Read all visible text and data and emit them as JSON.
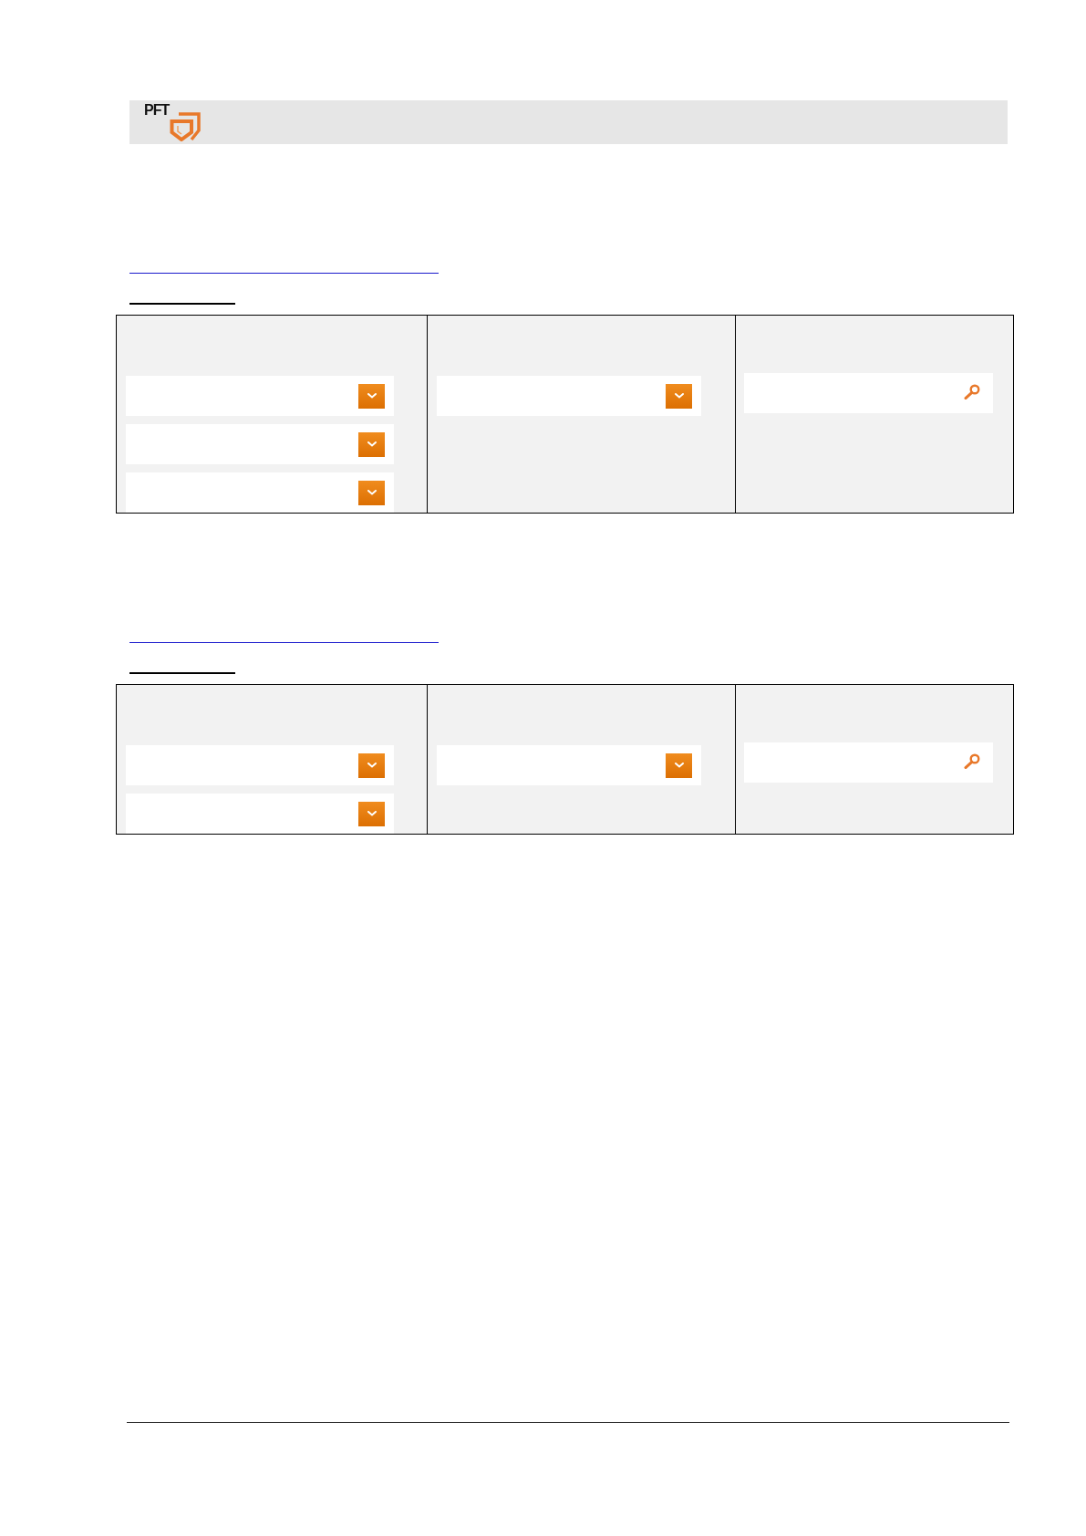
{
  "header": {
    "logo": {
      "text": "PFT"
    }
  },
  "sections": [
    {
      "table": {
        "columns": [
          {
            "fields": [
              {
                "kind": "dropdown"
              },
              {
                "kind": "dropdown"
              },
              {
                "kind": "dropdown"
              }
            ]
          },
          {
            "fields": [
              {
                "kind": "dropdown"
              }
            ]
          },
          {
            "fields": [
              {
                "kind": "search"
              }
            ]
          }
        ]
      }
    },
    {
      "table": {
        "columns": [
          {
            "fields": [
              {
                "kind": "dropdown"
              },
              {
                "kind": "dropdown"
              }
            ]
          },
          {
            "fields": [
              {
                "kind": "dropdown"
              }
            ]
          },
          {
            "fields": [
              {
                "kind": "search"
              }
            ]
          }
        ]
      }
    }
  ]
}
